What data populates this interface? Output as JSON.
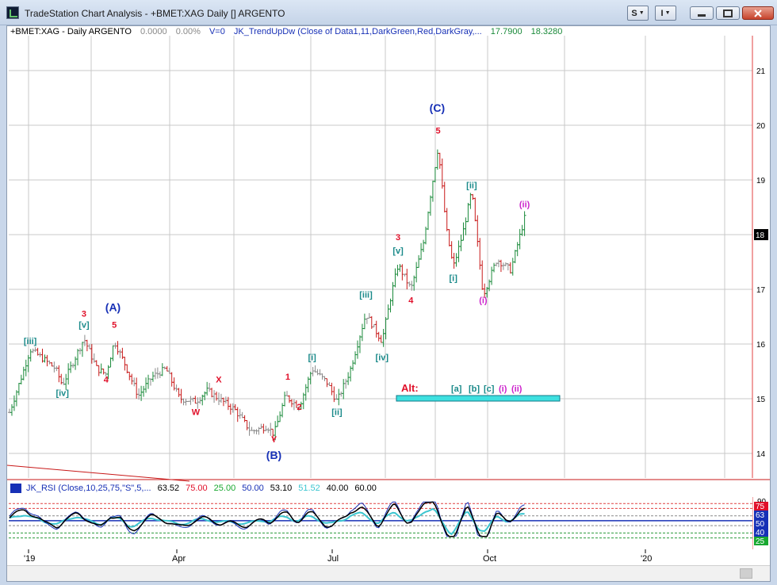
{
  "window": {
    "title": "TradeStation Chart Analysis - +BMET:XAG Daily [] ARGENTO",
    "btn_s": "S",
    "btn_i": "I"
  },
  "header": {
    "symbol": "+BMET:XAG - Daily  ARGENTO",
    "v1": "0.0000",
    "v2": "0.00%",
    "v3": "V=0",
    "indicator": "JK_TrendUpDw (Close of Data1,11,DarkGreen,Red,DarkGray,...",
    "ind_v1": "17.7900",
    "ind_v2": "18.3280"
  },
  "rsi_header": {
    "label": "JK_RSI (Close,10,25,75,\"S\",5,...",
    "v1": "63.52",
    "v2": "75.00",
    "v3": "25.00",
    "v4": "50.00",
    "v5": "53.10",
    "v6": "51.52",
    "v7": "40.00",
    "v8": "60.00"
  },
  "price_axis": {
    "ticks": [
      {
        "label": "21",
        "value": 21
      },
      {
        "label": "20",
        "value": 20
      },
      {
        "label": "19",
        "value": 19
      },
      {
        "label": "18",
        "value": 18
      },
      {
        "label": "17",
        "value": 17
      },
      {
        "label": "16",
        "value": 16
      },
      {
        "label": "15",
        "value": 15
      },
      {
        "label": "14",
        "value": 14
      }
    ],
    "current": {
      "label": "18",
      "value": 18
    }
  },
  "rsi_axis": {
    "ticks": [
      {
        "label": "90",
        "value": 90
      }
    ],
    "badges": [
      {
        "label": "75",
        "value": 75,
        "color": "#e0102a"
      },
      {
        "label": "63",
        "value": 63,
        "color": "#1730b6"
      },
      {
        "label": "50",
        "value": 50,
        "color": "#1730b6"
      },
      {
        "label": "40",
        "value": 40,
        "color": "#1730b6"
      },
      {
        "label": "25",
        "value": 25,
        "color": "#18a830"
      }
    ]
  },
  "time_axis": [
    "'19",
    "Apr",
    "Jul",
    "Oct",
    "'20"
  ],
  "alt_label": {
    "alt": "Alt:",
    "labels": [
      "[a]",
      "[b]",
      "[c]",
      "(i)",
      "(ii)"
    ]
  },
  "wave_labels": [
    {
      "text": "[iii]",
      "color": "#1a8a8a",
      "x": 0.045,
      "y": 16.0
    },
    {
      "text": "[iv]",
      "color": "#1a8a8a",
      "x": 0.115,
      "y": 15.05
    },
    {
      "text": "3",
      "color": "#e0102a",
      "x": 0.162,
      "y": 16.5
    },
    {
      "text": "[v]",
      "color": "#1a8a8a",
      "x": 0.162,
      "y": 16.3
    },
    {
      "text": "(A)",
      "color": "#1730b6",
      "x": 0.225,
      "y": 16.6
    },
    {
      "text": "5",
      "color": "#e0102a",
      "x": 0.228,
      "y": 16.3
    },
    {
      "text": "4",
      "color": "#e0102a",
      "x": 0.21,
      "y": 15.3
    },
    {
      "text": "W",
      "color": "#e0102a",
      "x": 0.405,
      "y": 14.7
    },
    {
      "text": "X",
      "color": "#e0102a",
      "x": 0.455,
      "y": 15.3
    },
    {
      "text": "Y",
      "color": "#e0102a",
      "x": 0.575,
      "y": 14.2
    },
    {
      "text": "(B)",
      "color": "#1730b6",
      "x": 0.575,
      "y": 13.9
    },
    {
      "text": "1",
      "color": "#e0102a",
      "x": 0.605,
      "y": 15.35
    },
    {
      "text": "2",
      "color": "#e0102a",
      "x": 0.63,
      "y": 14.8
    },
    {
      "text": "[i]",
      "color": "#1a8a8a",
      "x": 0.658,
      "y": 15.7
    },
    {
      "text": "[ii]",
      "color": "#1a8a8a",
      "x": 0.712,
      "y": 14.7
    },
    {
      "text": "[iii]",
      "color": "#1a8a8a",
      "x": 0.775,
      "y": 16.85
    },
    {
      "text": "[iv]",
      "color": "#1a8a8a",
      "x": 0.81,
      "y": 15.7
    },
    {
      "text": "3",
      "color": "#e0102a",
      "x": 0.845,
      "y": 17.9
    },
    {
      "text": "[v]",
      "color": "#1a8a8a",
      "x": 0.845,
      "y": 17.65
    },
    {
      "text": "4",
      "color": "#e0102a",
      "x": 0.873,
      "y": 16.75
    },
    {
      "text": "(C)",
      "color": "#1730b6",
      "x": 0.93,
      "y": 20.25
    },
    {
      "text": "5",
      "color": "#e0102a",
      "x": 0.932,
      "y": 19.85
    },
    {
      "text": "[i]",
      "color": "#1a8a8a",
      "x": 0.965,
      "y": 17.15
    },
    {
      "text": "[ii]",
      "color": "#1a8a8a",
      "x": 1.005,
      "y": 18.85
    },
    {
      "text": "(i)",
      "color": "#cc22cc",
      "x": 1.03,
      "y": 16.75
    },
    {
      "text": "(ii)",
      "color": "#cc22cc",
      "x": 1.12,
      "y": 18.5
    }
  ]
}
